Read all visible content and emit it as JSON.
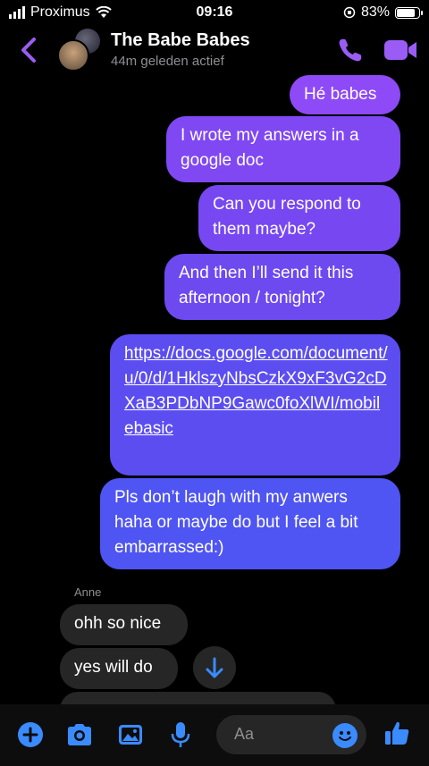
{
  "status_bar": {
    "carrier": "Proximus",
    "time": "09:16",
    "battery": "83%",
    "battery_level": 0.83
  },
  "header": {
    "title": "The Babe Babes",
    "subtitle": "44m geleden actief"
  },
  "messages": [
    {
      "text": "Hé babes",
      "color": "#8e4af6"
    },
    {
      "text": "I wrote my answers in a google doc",
      "color": "#8048f3"
    },
    {
      "text": "Can you respond to them maybe?",
      "color": "#7747f1"
    },
    {
      "text": "And then I’ll send it this afternoon / tonight?",
      "color": "#6d49f0"
    },
    {
      "text": "https://docs.google.com/document/u/0/d/1HklszyNbsCzkX9xF3vG2cDXaB3PDbNP9Gawc0foXlWI/mobilebasic",
      "color": "#5c4df1"
    },
    {
      "text": "Pls don’t laugh with my anwers haha or maybe do but I feel a bit embarrassed:)",
      "color": "#4f55f2"
    }
  ],
  "received": {
    "sender": "Anne",
    "messages": [
      "ohh so nice",
      "yes will do"
    ]
  },
  "composer": {
    "placeholder": "Aa"
  },
  "colors": {
    "accent": "#9b5cf6",
    "blue": "#3a8bfd"
  }
}
